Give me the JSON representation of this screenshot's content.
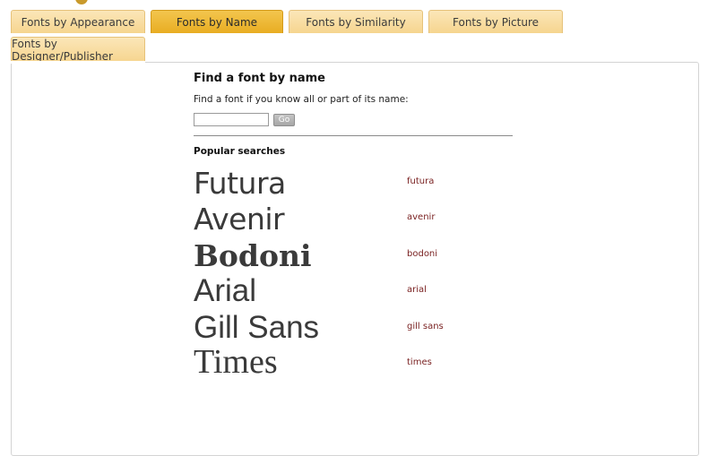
{
  "tabs": {
    "appearance": "Fonts by Appearance",
    "name": "Fonts by Name",
    "similarity": "Fonts by Similarity",
    "picture": "Fonts by Picture",
    "designer": "Fonts by Designer/Publisher"
  },
  "find": {
    "heading": "Find a font by name",
    "intro": "Find a font if you know all or part of its name:",
    "input_value": "",
    "go_label": "Go"
  },
  "popular": {
    "heading": "Popular searches",
    "items": [
      {
        "sample": "Futura",
        "link": "futura"
      },
      {
        "sample": "Avenir",
        "link": "avenir"
      },
      {
        "sample": "Bodoni",
        "link": "bodoni"
      },
      {
        "sample": "Arial",
        "link": "arial"
      },
      {
        "sample": "Gill Sans",
        "link": "gill sans"
      },
      {
        "sample": "Times",
        "link": "times"
      }
    ]
  },
  "colors": {
    "tab_inactive": "#f6d58f",
    "tab_active": "#e8ad22",
    "link": "#7a2222",
    "sample_text": "#3a3a3a"
  }
}
